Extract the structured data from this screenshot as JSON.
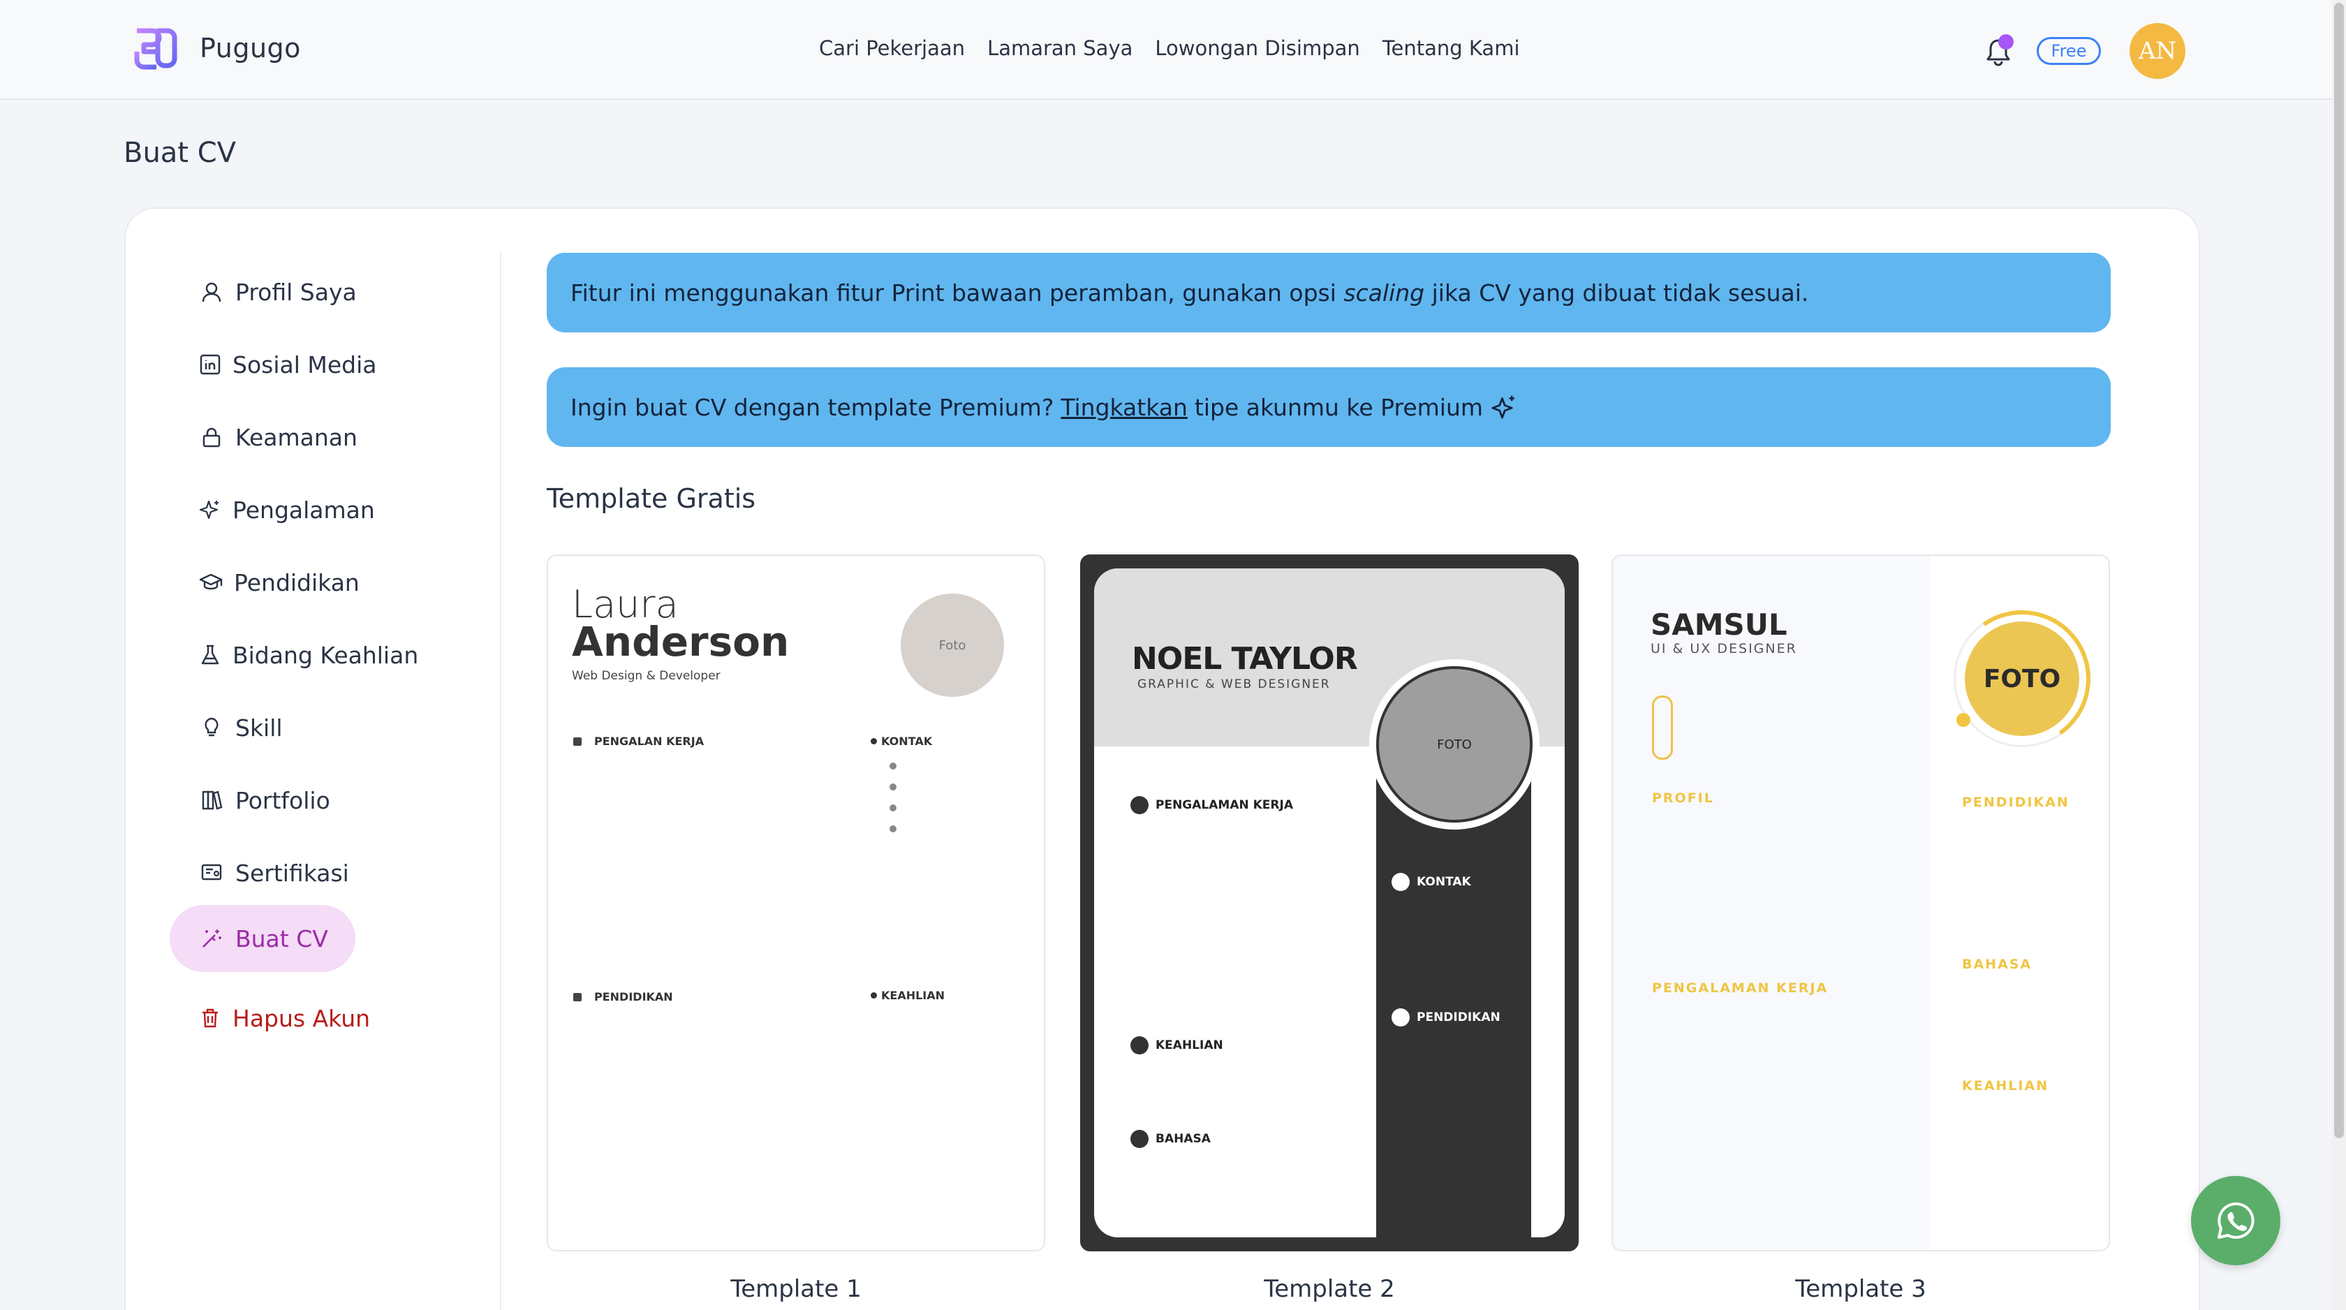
{
  "brand": {
    "name": "Pugugo"
  },
  "nav": {
    "links": [
      "Cari Pekerjaan",
      "Lamaran Saya",
      "Lowongan Disimpan",
      "Tentang Kami"
    ]
  },
  "user": {
    "plan": "Free",
    "initials": "AN"
  },
  "page": {
    "title": "Buat CV"
  },
  "sidebar": {
    "items": [
      {
        "label": "Profil Saya",
        "icon": "user-icon"
      },
      {
        "label": "Sosial Media",
        "icon": "linkedin-icon"
      },
      {
        "label": "Keamanan",
        "icon": "lock-icon"
      },
      {
        "label": "Pengalaman",
        "icon": "sparkle-icon"
      },
      {
        "label": "Pendidikan",
        "icon": "graduation-cap-icon"
      },
      {
        "label": "Bidang Keahlian",
        "icon": "flask-icon"
      },
      {
        "label": "Skill",
        "icon": "lightbulb-icon"
      },
      {
        "label": "Portfolio",
        "icon": "books-icon"
      },
      {
        "label": "Sertifikasi",
        "icon": "certificate-icon"
      },
      {
        "label": "Buat CV",
        "icon": "magic-wand-icon",
        "active": true
      },
      {
        "label": "Hapus Akun",
        "icon": "trash-icon",
        "danger": true
      }
    ]
  },
  "alerts": {
    "print": {
      "before": "Fitur ini menggunakan fitur Print bawaan peramban, gunakan opsi ",
      "italic": "scaling",
      "after": " jika CV yang dibuat tidak sesuai."
    },
    "premium": {
      "before": "Ingin buat CV dengan template Premium?",
      "link": "Tingkatkan",
      "after": "tipe akunmu ke Premium"
    }
  },
  "section": {
    "title": "Template Gratis"
  },
  "templates": [
    {
      "label": "Template 1",
      "first_name": "Laura",
      "last_name": "Anderson",
      "role": "Web Design & Developer",
      "photo": "Foto",
      "sections": {
        "experience": "PENGALAN KERJA",
        "contact": "KONTAK",
        "education": "PENDIDIKAN",
        "skills": "KEAHLIAN"
      }
    },
    {
      "label": "Template 2",
      "name": "NOEL TAYLOR",
      "role": "GRAPHIC & WEB DESIGNER",
      "photo": "FOTO",
      "sections": {
        "experience": "PENGALAMAN KERJA",
        "contact": "KONTAK",
        "education": "PENDIDIKAN",
        "skills": "KEAHLIAN",
        "language": "BAHASA"
      }
    },
    {
      "label": "Template 3",
      "name": "SAMSUL",
      "role": "UI & UX DESIGNER",
      "photo": "FOTO",
      "sections": {
        "profile": "PROFIL",
        "education": "PENDIDIKAN",
        "language": "BAHASA",
        "experience": "PENGALAMAN KERJA",
        "skills": "KEAHLIAN"
      }
    }
  ],
  "colors": {
    "alert_bg": "#60b6ef",
    "active_bg": "#f5dcf7",
    "active_text": "#9b2aa8",
    "danger": "#b91c1c",
    "accent_yellow": "#f0c542",
    "whatsapp": "#5aae6a",
    "brand_purple": "#a855f7"
  }
}
